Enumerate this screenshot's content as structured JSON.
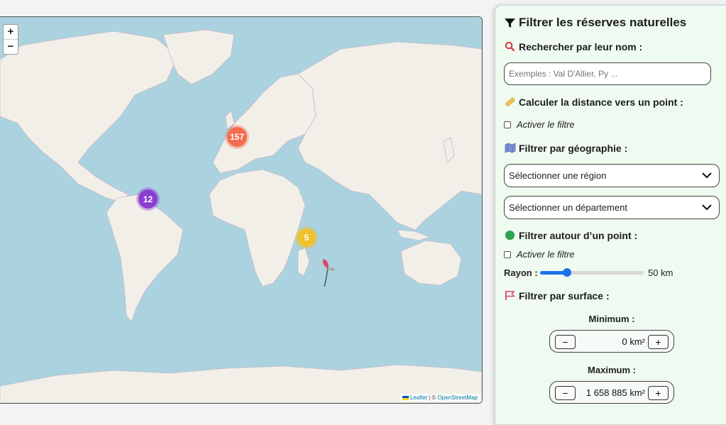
{
  "map": {
    "zoom_in": "+",
    "zoom_out": "−",
    "clusters": [
      {
        "label": "157",
        "color": "#f26c4f"
      },
      {
        "label": "12",
        "color": "#8a3fd1"
      },
      {
        "label": "5",
        "color": "#f2c12e"
      }
    ],
    "attribution": {
      "leaflet": "Leaflet",
      "sep": " | © ",
      "osm": "OpenStreetMap"
    }
  },
  "panel": {
    "title": "Filtrer les réserves naturelles",
    "search": {
      "label": "Rechercher par leur nom :",
      "placeholder": "Exemples : Val D'Allier, Py ..."
    },
    "distance": {
      "label": "Calculer la distance vers un point :",
      "checkbox_label": "Activer le filtre"
    },
    "geography": {
      "label": "Filtrer par géographie :",
      "region_select": "Sélectionner une région",
      "department_select": "Sélectionner un département"
    },
    "around_point": {
      "label": "Filtrer autour d’un point :",
      "checkbox_label": "Activer le filtre",
      "radius_label": "Rayon :",
      "radius_value": "50 km",
      "radius_fraction": 0.26
    },
    "surface": {
      "label": "Filtrer par surface :",
      "min_label": "Minimum :",
      "min_value": "0 km²",
      "max_label": "Maximum :",
      "max_value": "1 658 885 km²",
      "minus": "−",
      "plus": "+"
    }
  },
  "colors": {
    "sea": "#aad3df",
    "land": "#f2efe9",
    "panel_bg": "#effaf1",
    "accent": "#1a73e8"
  }
}
